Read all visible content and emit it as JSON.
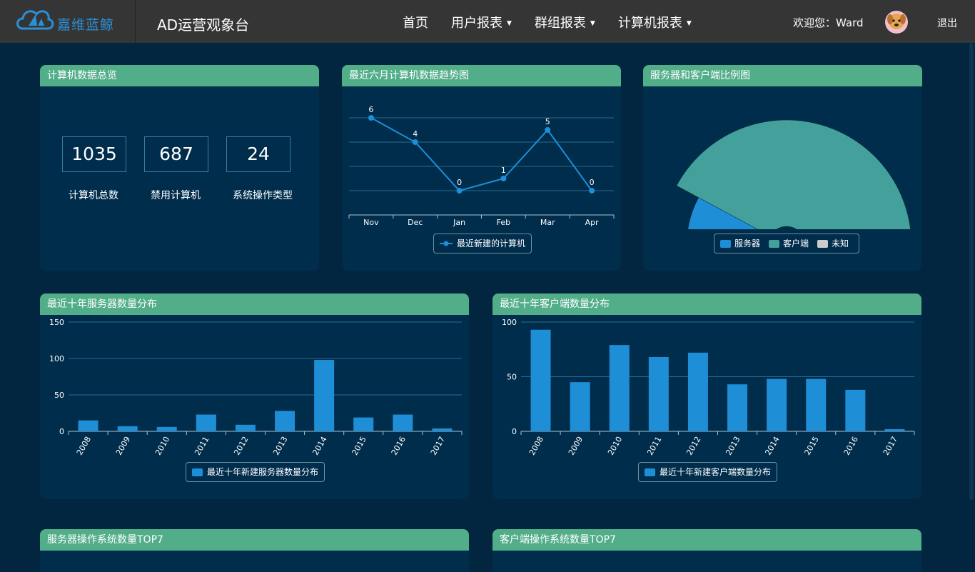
{
  "nav": {
    "brand_text": "嘉维蓝鲸",
    "app_title": "AD运营观象台",
    "menu": [
      {
        "label": "首页",
        "dropdown": false
      },
      {
        "label": "用户报表",
        "dropdown": true
      },
      {
        "label": "群组报表",
        "dropdown": true
      },
      {
        "label": "计算机报表",
        "dropdown": true
      }
    ],
    "welcome": "欢迎您：Ward",
    "logout": "退出"
  },
  "colors": {
    "accent_green": "#52ad89",
    "bar_blue": "#1e8ed6",
    "client_teal": "#44a09a",
    "unknown_gray": "#cccccc"
  },
  "overview": {
    "title": "计算机数据总览",
    "stats": [
      {
        "value": "1035",
        "label": "计算机总数"
      },
      {
        "value": "687",
        "label": "禁用计算机"
      },
      {
        "value": "24",
        "label": "系统操作类型"
      }
    ]
  },
  "trend": {
    "title": "最近六月计算机数据趋势图",
    "chart_data": {
      "type": "line",
      "categories": [
        "Nov",
        "Dec",
        "Jan",
        "Feb",
        "Mar",
        "Apr"
      ],
      "series": [
        {
          "name": "最近新建的计算机",
          "values": [
            6,
            4,
            0,
            1,
            5,
            0
          ]
        }
      ],
      "ylim": [
        -2,
        8
      ],
      "grid": true,
      "legend": "bottom"
    }
  },
  "ratio": {
    "title": "服务器和客户端比例图",
    "chart_data": {
      "type": "pie",
      "series": [
        {
          "name": "服务器",
          "value": 200
        },
        {
          "name": "客户端",
          "value": 580
        },
        {
          "name": "未知",
          "value": 10
        }
      ],
      "legend": "bottom"
    }
  },
  "servers": {
    "title": "最近十年服务器数量分布",
    "chart_data": {
      "type": "bar",
      "categories": [
        "2008",
        "2009",
        "2010",
        "2011",
        "2012",
        "2013",
        "2014",
        "2015",
        "2016",
        "2017"
      ],
      "series": [
        {
          "name": "最近十年新建服务器数量分布",
          "values": [
            15,
            7,
            6,
            23,
            9,
            28,
            98,
            19,
            23,
            4
          ]
        }
      ],
      "yticks": [
        "0",
        "50",
        "100",
        "150"
      ],
      "ylim": [
        0,
        150
      ],
      "legend": "bottom"
    }
  },
  "clients": {
    "title": "最近十年客户端数量分布",
    "chart_data": {
      "type": "bar",
      "categories": [
        "2008",
        "2009",
        "2010",
        "2011",
        "2012",
        "2013",
        "2014",
        "2015",
        "2016",
        "2017"
      ],
      "series": [
        {
          "name": "最近十年新建客户端数量分布",
          "values": [
            93,
            45,
            79,
            68,
            72,
            43,
            48,
            48,
            38,
            2
          ]
        }
      ],
      "yticks": [
        "0",
        "50",
        "100"
      ],
      "ylim": [
        0,
        100
      ],
      "legend": "bottom"
    }
  },
  "server_os_title": "服务器操作系统数量TOP7",
  "client_os_title": "客户端操作系统数量TOP7"
}
